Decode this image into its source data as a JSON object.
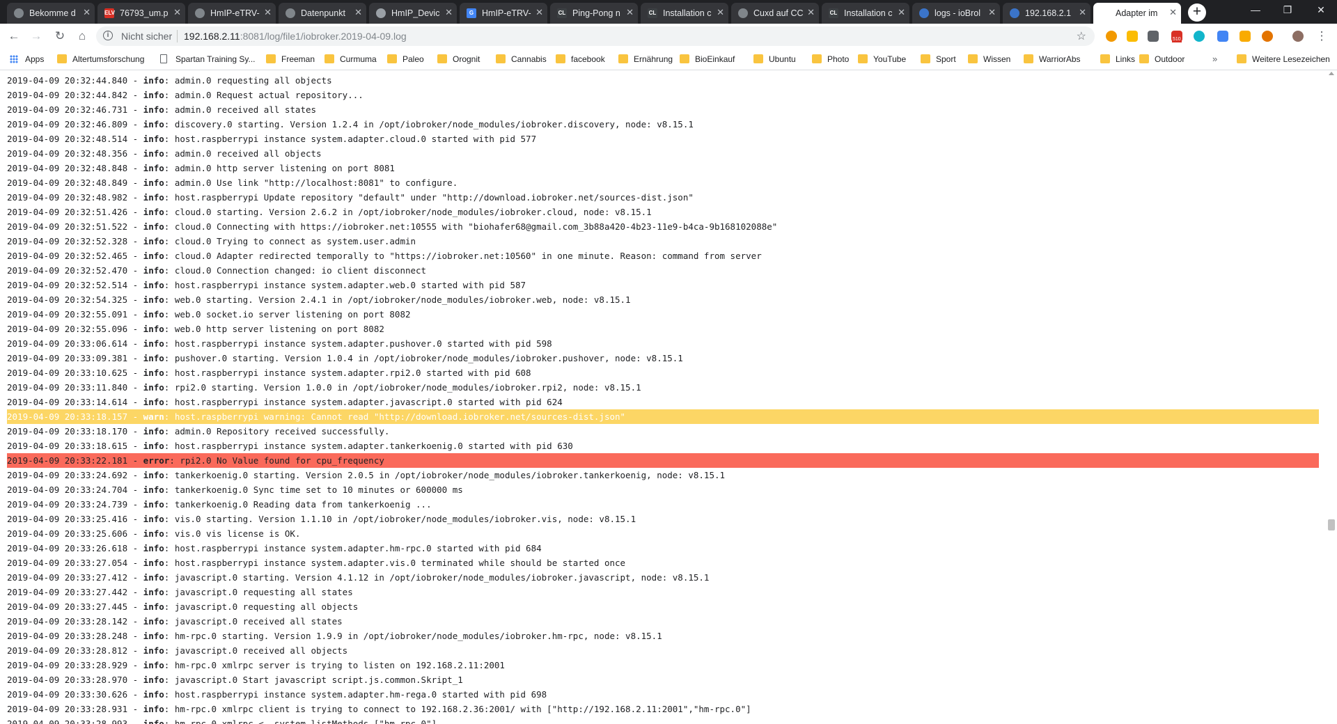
{
  "tabs": [
    {
      "title": "Bekomme d",
      "icon": "gear-icon",
      "color": "#80868b"
    },
    {
      "title": "76793_um.p",
      "icon": "elv-icon",
      "color": "#d93025",
      "glyph": "ELV"
    },
    {
      "title": "HmIP-eTRV-",
      "icon": "gear-icon",
      "color": "#80868b"
    },
    {
      "title": "Datenpunkt",
      "icon": "gear-icon",
      "color": "#80868b"
    },
    {
      "title": "HmIP_Devic",
      "icon": "document-icon",
      "color": "#9aa0a6"
    },
    {
      "title": "HmIP-eTRV-",
      "icon": "google-icon",
      "color": "#4285f4",
      "glyph": "G"
    },
    {
      "title": "Ping-Pong n",
      "icon": "cl-icon",
      "color": "#3c4043",
      "glyph": "CL"
    },
    {
      "title": "Installation c",
      "icon": "cl-icon",
      "color": "#3c4043",
      "glyph": "CL"
    },
    {
      "title": "Cuxd auf CC",
      "icon": "gear-icon",
      "color": "#80868b"
    },
    {
      "title": "Installation c",
      "icon": "cl-icon",
      "color": "#3c4043",
      "glyph": "CL"
    },
    {
      "title": "logs - ioBrol",
      "icon": "iobroker-icon",
      "color": "#3b74c9"
    },
    {
      "title": "192.168.2.1",
      "icon": "iobroker-icon",
      "color": "#3b74c9"
    },
    {
      "title": "Adapter im",
      "icon": "",
      "color": "#ffffff"
    }
  ],
  "active_tab": 12,
  "toolbar": {
    "security": "Nicht sicher",
    "url_host": "192.168.2.11",
    "url_rest": ":8081/log/file1/iobroker.2019-04-09.log",
    "extension_badge": "510"
  },
  "bookmarks": [
    {
      "label": "Apps",
      "icon": "apps-icon"
    },
    {
      "label": "Altertumsforschung",
      "icon": "folder-icon"
    },
    {
      "label": "Spartan Training Sy...",
      "icon": "page-icon"
    },
    {
      "label": "Freeman",
      "icon": "folder-icon"
    },
    {
      "label": "Curmuma",
      "icon": "folder-icon"
    },
    {
      "label": "Paleo",
      "icon": "folder-icon"
    },
    {
      "label": "Orognit",
      "icon": "folder-icon"
    },
    {
      "label": "Cannabis",
      "icon": "folder-icon"
    },
    {
      "label": "facebook",
      "icon": "folder-icon"
    },
    {
      "label": "Ernährung",
      "icon": "folder-icon"
    },
    {
      "label": "BioEinkauf",
      "icon": "folder-icon"
    },
    {
      "label": "Ubuntu",
      "icon": "folder-icon"
    },
    {
      "label": "Photo",
      "icon": "folder-icon"
    },
    {
      "label": "YouTube",
      "icon": "folder-icon"
    },
    {
      "label": "Sport",
      "icon": "folder-icon"
    },
    {
      "label": "Wissen",
      "icon": "folder-icon"
    },
    {
      "label": "WarriorAbs",
      "icon": "folder-icon"
    },
    {
      "label": "Links",
      "icon": "folder-icon"
    },
    {
      "label": "Outdoor",
      "icon": "folder-icon"
    }
  ],
  "bookmarks_more": "»",
  "bookmarks_other": "Weitere Lesezeichen",
  "log": [
    {
      "ts": "2019-04-09 20:32:44.840",
      "level": "info",
      "msg": "admin.0 requesting all objects"
    },
    {
      "ts": "2019-04-09 20:32:44.842",
      "level": "info",
      "msg": "admin.0 Request actual repository..."
    },
    {
      "ts": "2019-04-09 20:32:46.731",
      "level": "info",
      "msg": "admin.0 received all states"
    },
    {
      "ts": "2019-04-09 20:32:46.809",
      "level": "info",
      "msg": "discovery.0 starting. Version 1.2.4 in /opt/iobroker/node_modules/iobroker.discovery, node: v8.15.1"
    },
    {
      "ts": "2019-04-09 20:32:48.514",
      "level": "info",
      "msg": "host.raspberrypi instance system.adapter.cloud.0 started with pid 577"
    },
    {
      "ts": "2019-04-09 20:32:48.356",
      "level": "info",
      "msg": "admin.0 received all objects"
    },
    {
      "ts": "2019-04-09 20:32:48.848",
      "level": "info",
      "msg": "admin.0 http server listening on port 8081"
    },
    {
      "ts": "2019-04-09 20:32:48.849",
      "level": "info",
      "msg": "admin.0 Use link \"http://localhost:8081\" to configure."
    },
    {
      "ts": "2019-04-09 20:32:48.982",
      "level": "info",
      "msg": "host.raspberrypi Update repository \"default\" under \"http://download.iobroker.net/sources-dist.json\""
    },
    {
      "ts": "2019-04-09 20:32:51.426",
      "level": "info",
      "msg": "cloud.0 starting. Version 2.6.2 in /opt/iobroker/node_modules/iobroker.cloud, node: v8.15.1"
    },
    {
      "ts": "2019-04-09 20:32:51.522",
      "level": "info",
      "msg": "cloud.0 Connecting with https://iobroker.net:10555 with \"biohafer68@gmail.com_3b88a420-4b23-11e9-b4ca-9b168102088e\""
    },
    {
      "ts": "2019-04-09 20:32:52.328",
      "level": "info",
      "msg": "cloud.0 Trying to connect as system.user.admin"
    },
    {
      "ts": "2019-04-09 20:32:52.465",
      "level": "info",
      "msg": "cloud.0 Adapter redirected temporally to \"https://iobroker.net:10560\" in one minute. Reason: command from server"
    },
    {
      "ts": "2019-04-09 20:32:52.470",
      "level": "info",
      "msg": "cloud.0 Connection changed: io client disconnect"
    },
    {
      "ts": "2019-04-09 20:32:52.514",
      "level": "info",
      "msg": "host.raspberrypi instance system.adapter.web.0 started with pid 587"
    },
    {
      "ts": "2019-04-09 20:32:54.325",
      "level": "info",
      "msg": "web.0 starting. Version 2.4.1 in /opt/iobroker/node_modules/iobroker.web, node: v8.15.1"
    },
    {
      "ts": "2019-04-09 20:32:55.091",
      "level": "info",
      "msg": "web.0 socket.io server listening on port 8082"
    },
    {
      "ts": "2019-04-09 20:32:55.096",
      "level": "info",
      "msg": "web.0 http server listening on port 8082"
    },
    {
      "ts": "2019-04-09 20:33:06.614",
      "level": "info",
      "msg": "host.raspberrypi instance system.adapter.pushover.0 started with pid 598"
    },
    {
      "ts": "2019-04-09 20:33:09.381",
      "level": "info",
      "msg": "pushover.0 starting. Version 1.0.4 in /opt/iobroker/node_modules/iobroker.pushover, node: v8.15.1"
    },
    {
      "ts": "2019-04-09 20:33:10.625",
      "level": "info",
      "msg": "host.raspberrypi instance system.adapter.rpi2.0 started with pid 608"
    },
    {
      "ts": "2019-04-09 20:33:11.840",
      "level": "info",
      "msg": "rpi2.0 starting. Version 1.0.0 in /opt/iobroker/node_modules/iobroker.rpi2, node: v8.15.1"
    },
    {
      "ts": "2019-04-09 20:33:14.614",
      "level": "info",
      "msg": "host.raspberrypi instance system.adapter.javascript.0 started with pid 624"
    },
    {
      "ts": "2019-04-09 20:33:18.157",
      "level": "warn",
      "msg": "host.raspberrypi warning: Cannot read \"http://download.iobroker.net/sources-dist.json\""
    },
    {
      "ts": "2019-04-09 20:33:18.170",
      "level": "info",
      "msg": "admin.0 Repository received successfully."
    },
    {
      "ts": "2019-04-09 20:33:18.615",
      "level": "info",
      "msg": "host.raspberrypi instance system.adapter.tankerkoenig.0 started with pid 630"
    },
    {
      "ts": "2019-04-09 20:33:22.181",
      "level": "error",
      "msg": "rpi2.0 No Value found for cpu_frequency"
    },
    {
      "ts": "2019-04-09 20:33:24.692",
      "level": "info",
      "msg": "tankerkoenig.0 starting. Version 2.0.5 in /opt/iobroker/node_modules/iobroker.tankerkoenig, node: v8.15.1"
    },
    {
      "ts": "2019-04-09 20:33:24.704",
      "level": "info",
      "msg": "tankerkoenig.0 Sync time set to 10 minutes or 600000 ms"
    },
    {
      "ts": "2019-04-09 20:33:24.739",
      "level": "info",
      "msg": "tankerkoenig.0 Reading data from tankerkoenig ..."
    },
    {
      "ts": "2019-04-09 20:33:25.416",
      "level": "info",
      "msg": "vis.0 starting. Version 1.1.10 in /opt/iobroker/node_modules/iobroker.vis, node: v8.15.1"
    },
    {
      "ts": "2019-04-09 20:33:25.606",
      "level": "info",
      "msg": "vis.0 vis license is OK."
    },
    {
      "ts": "2019-04-09 20:33:26.618",
      "level": "info",
      "msg": "host.raspberrypi instance system.adapter.hm-rpc.0 started with pid 684"
    },
    {
      "ts": "2019-04-09 20:33:27.054",
      "level": "info",
      "msg": "host.raspberrypi instance system.adapter.vis.0 terminated while should be started once"
    },
    {
      "ts": "2019-04-09 20:33:27.412",
      "level": "info",
      "msg": "javascript.0 starting. Version 4.1.12 in /opt/iobroker/node_modules/iobroker.javascript, node: v8.15.1"
    },
    {
      "ts": "2019-04-09 20:33:27.442",
      "level": "info",
      "msg": "javascript.0 requesting all states"
    },
    {
      "ts": "2019-04-09 20:33:27.445",
      "level": "info",
      "msg": "javascript.0 requesting all objects"
    },
    {
      "ts": "2019-04-09 20:33:28.142",
      "level": "info",
      "msg": "javascript.0 received all states"
    },
    {
      "ts": "2019-04-09 20:33:28.248",
      "level": "info",
      "msg": "hm-rpc.0 starting. Version 1.9.9 in /opt/iobroker/node_modules/iobroker.hm-rpc, node: v8.15.1"
    },
    {
      "ts": "2019-04-09 20:33:28.812",
      "level": "info",
      "msg": "javascript.0 received all objects"
    },
    {
      "ts": "2019-04-09 20:33:28.929",
      "level": "info",
      "msg": "hm-rpc.0 xmlrpc server is trying to listen on 192.168.2.11:2001"
    },
    {
      "ts": "2019-04-09 20:33:28.970",
      "level": "info",
      "msg": "javascript.0 Start javascript script.js.common.Skript_1"
    },
    {
      "ts": "2019-04-09 20:33:30.626",
      "level": "info",
      "msg": "host.raspberrypi instance system.adapter.hm-rega.0 started with pid 698"
    },
    {
      "ts": "2019-04-09 20:33:28.931",
      "level": "info",
      "msg": "hm-rpc.0 xmlrpc client is trying to connect to 192.168.2.36:2001/ with [\"http://192.168.2.11:2001\",\"hm-rpc.0\"]"
    },
    {
      "ts": "2019-04-09 20:33:28.993",
      "level": "info",
      "msg": "hm-rpc.0 xmlrpc <- system.listMethods [\"hm-rpc.0\"]"
    }
  ]
}
